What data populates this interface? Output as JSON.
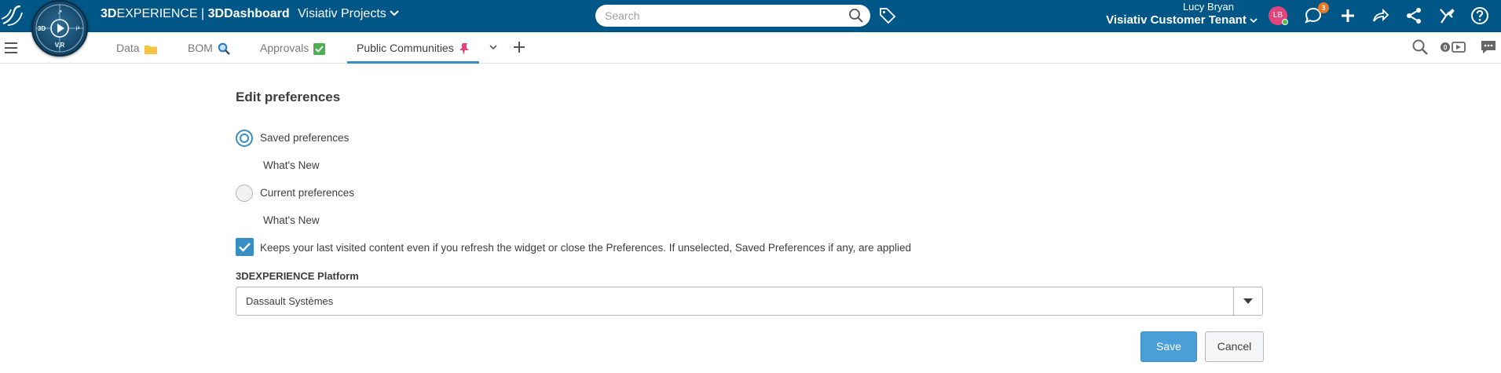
{
  "header": {
    "brand_bold": "3D",
    "brand_mid": "EXPERIENCE | ",
    "brand_app": "3DDashboard",
    "project": "Visiativ Projects",
    "search_placeholder": "Search",
    "user_name": "Lucy Bryan",
    "tenant": "Visiativ Customer Tenant",
    "avatar_initials": "LB",
    "notification_count": "3",
    "compass": {
      "top": "↗",
      "left": "3D",
      "right": "i³",
      "bottom": "V,R"
    }
  },
  "tabs": [
    {
      "label": "Data",
      "icon": "folder-icon"
    },
    {
      "label": "BOM",
      "icon": "magnifier-icon"
    },
    {
      "label": "Approvals",
      "icon": "checkmark-icon"
    },
    {
      "label": "Public Communities",
      "icon": "pin-icon",
      "active": true
    }
  ],
  "form": {
    "title": "Edit preferences",
    "saved_label": "Saved preferences",
    "saved_sub": "What's New",
    "current_label": "Current preferences",
    "current_sub": "What's New",
    "keep_label": "Keeps your last visited content even if you refresh the widget or close the Preferences. If unselected, Saved Preferences if any, are applied",
    "keep_checked": true,
    "platform_label": "3DEXPERIENCE Platform",
    "platform_value": "Dassault Systèmes",
    "save_label": "Save",
    "cancel_label": "Cancel"
  },
  "colors": {
    "topbar": "#005686",
    "accent": "#368ec4",
    "save_button": "#4a9fd8"
  }
}
